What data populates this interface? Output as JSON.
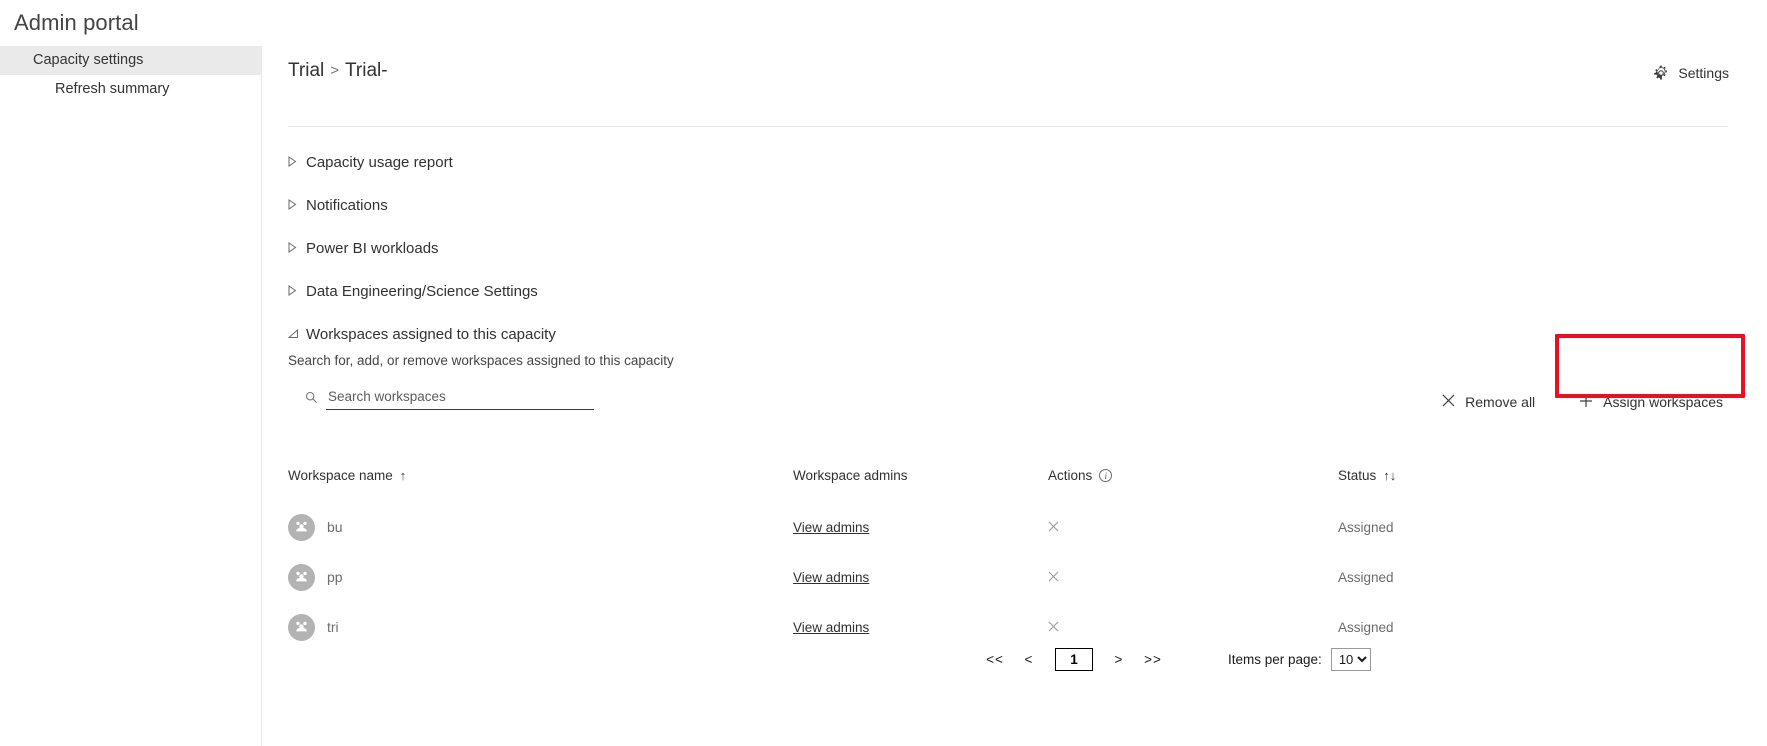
{
  "app": {
    "title": "Admin portal"
  },
  "sidebar": {
    "items": [
      {
        "label": "Capacity settings",
        "level": 1,
        "selected": true
      },
      {
        "label": "Refresh summary",
        "level": 2,
        "selected": false
      }
    ]
  },
  "breadcrumb": {
    "root": "Trial",
    "separator": ">",
    "current": "Trial-"
  },
  "topbar": {
    "settings_label": "Settings",
    "settings_icon": "gear-icon"
  },
  "sections": [
    {
      "label": "Capacity usage report",
      "expanded": false,
      "icon": "chevron-right-icon"
    },
    {
      "label": "Notifications",
      "expanded": false,
      "icon": "chevron-right-icon"
    },
    {
      "label": "Power BI workloads",
      "expanded": false,
      "icon": "chevron-right-icon"
    },
    {
      "label": "Data Engineering/Science Settings",
      "expanded": false,
      "icon": "chevron-right-icon"
    },
    {
      "label": "Workspaces assigned to this capacity",
      "expanded": true,
      "icon": "chevron-down-icon"
    }
  ],
  "workspaces_section": {
    "description": "Search for, add, or remove workspaces assigned to this capacity",
    "search": {
      "placeholder": "Search workspaces",
      "value": "",
      "icon": "search-icon"
    },
    "commands": {
      "remove_all": {
        "label": "Remove all",
        "icon": "close-icon"
      },
      "assign": {
        "label": "Assign workspaces",
        "icon": "plus-icon",
        "highlighted": true
      }
    },
    "highlight_color": "#e81123"
  },
  "table": {
    "columns": [
      {
        "key": "name",
        "label": "Workspace name",
        "sort": "ascending",
        "sort_glyph": "↑"
      },
      {
        "key": "admins",
        "label": "Workspace admins",
        "sort": "none",
        "sort_glyph": ""
      },
      {
        "key": "actions",
        "label": "Actions",
        "sort": "none",
        "sort_glyph": "",
        "info": true
      },
      {
        "key": "status",
        "label": "Status",
        "sort": "sortable",
        "sort_glyph": "↑↓"
      }
    ],
    "rows": [
      {
        "name": "bu",
        "avatar": "group-icon",
        "admins_link": "View admins",
        "action_icon": "close-icon",
        "status": "Assigned"
      },
      {
        "name": "pp",
        "avatar": "group-icon",
        "admins_link": "View admins",
        "action_icon": "close-icon",
        "status": "Assigned"
      },
      {
        "name": "tri",
        "avatar": "group-icon",
        "admins_link": "View admins",
        "action_icon": "close-icon",
        "status": "Assigned"
      }
    ]
  },
  "pagination": {
    "first_label": "<<",
    "prev_label": "<",
    "current_page": "1",
    "next_label": ">",
    "last_label": ">>",
    "items_per_page_label": "Items per page:",
    "items_per_page_value": "10",
    "items_per_page_options": [
      "10"
    ]
  }
}
